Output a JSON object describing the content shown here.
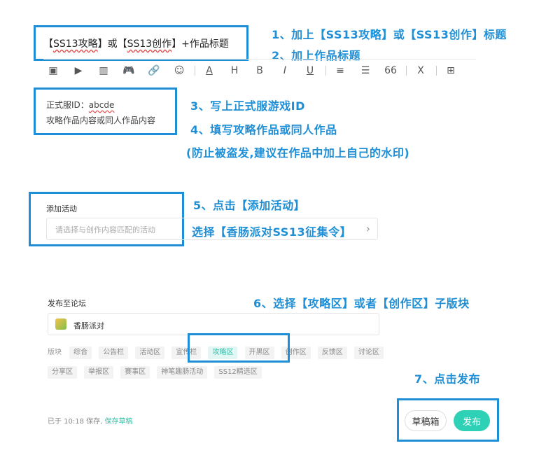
{
  "title_input": {
    "value_parts": [
      "【",
      "SS13攻略",
      "】或【",
      "SS13创作",
      "】+作品标题"
    ]
  },
  "notes": {
    "n1": "1、加上【SS13攻略】或【SS13创作】标题",
    "n2": "2、加上作品标题",
    "n3": "3、写上正式服游戏ID",
    "n4": "4、填写攻略作品或同人作品",
    "n4b": "(防止被盗发,建议在作品中加上自己的水印)",
    "n5": "5、点击【添加活动】",
    "n5b": "选择【香肠派对SS13征集令】",
    "n6": "6、选择【攻略区】或者【创作区】子版块",
    "n7": "7、点击发布"
  },
  "toolbar": {
    "icons": [
      "image-icon",
      "video-icon",
      "chart-icon",
      "gamepad-icon",
      "link-icon",
      "emoji-icon",
      "font-color-icon",
      "heading-icon",
      "bold-icon",
      "italic-icon",
      "underline-icon",
      "list-icon",
      "divider-icon",
      "quote-icon",
      "clear-format-icon",
      "insert-icon"
    ],
    "glyphs": [
      "▣",
      "▶",
      "▥",
      "🎮",
      "🔗",
      "☺",
      "A",
      "H",
      "B",
      "I",
      "U",
      "≡",
      "☰",
      "66",
      "X",
      "⊞"
    ]
  },
  "content": {
    "line1_prefix": "正式服ID：",
    "line1_value": "abcde",
    "line2": "攻略作品内容或同人作品内容"
  },
  "activity": {
    "label": "添加活动",
    "placeholder": "请选择与创作内容匹配的活动",
    "chevron": "›"
  },
  "forum": {
    "label": "发布至论坛",
    "selected": "香肠派对",
    "section_label": "版块",
    "tags_row1": [
      "综合",
      "公告栏",
      "活动区",
      "宣传栏",
      "攻略区",
      "开黑区",
      "创作区",
      "反馈区",
      "讨论区"
    ],
    "tags_row2": [
      "分享区",
      "举报区",
      "赛事区",
      "神笔趣肠活动",
      "SS12精选区"
    ],
    "active_tag": "攻略区"
  },
  "footer": {
    "saved_text": "已于 10:18 保存,",
    "save_draft_link": "保存草稿",
    "draft_button": "草稿箱",
    "publish_button": "发布"
  },
  "colors": {
    "annotation": "#1e8fd6",
    "accent": "#2ed1b5"
  }
}
